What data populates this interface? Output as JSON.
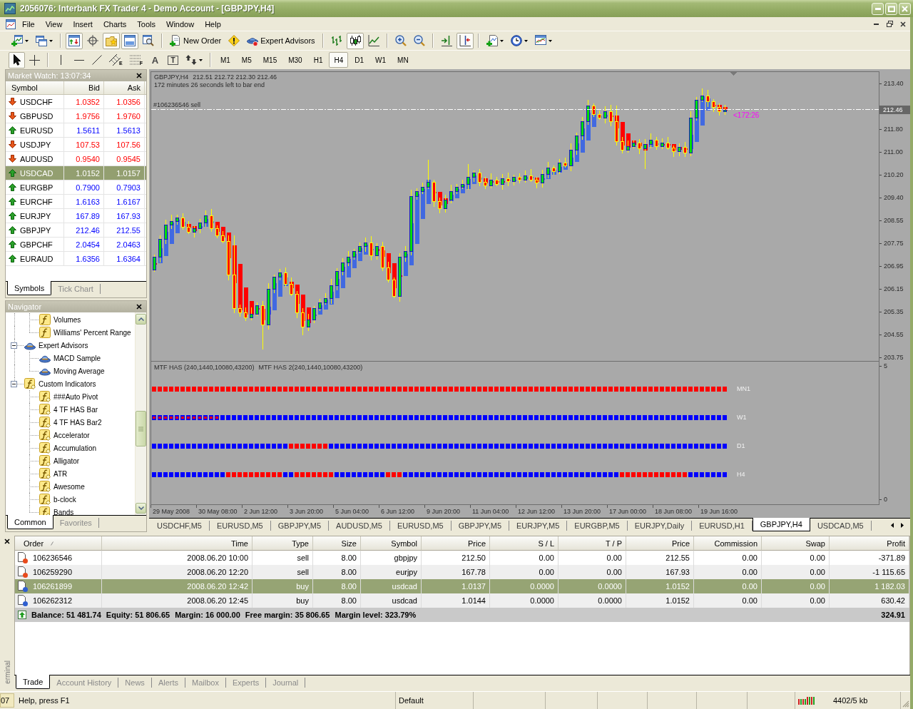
{
  "window": {
    "title": "2056076: Interbank FX Trader 4 - Demo Account - [GBPJPY,H4]"
  },
  "menu": [
    "File",
    "View",
    "Insert",
    "Charts",
    "Tools",
    "Window",
    "Help"
  ],
  "toolbar": [
    [
      {
        "pressed": false
      },
      {
        "pressed": false
      }
    ],
    [
      {
        "pressed": true
      },
      {
        "pressed": false
      },
      {
        "pressed": true
      },
      {
        "pressed": true
      },
      {
        "pressed": false
      }
    ],
    [
      {
        "label": "New Order",
        "pressed": false
      },
      {
        "pressed": false
      },
      {
        "label": "Expert Advisors",
        "pressed": false
      }
    ],
    [
      {
        "pressed": false
      },
      {
        "pressed": true
      },
      {
        "pressed": false
      }
    ],
    [
      {
        "pressed": false
      },
      {
        "pressed": false
      }
    ],
    [
      {
        "pressed": false
      },
      {
        "pressed": true
      }
    ],
    [
      {
        "pressed": false
      },
      {
        "pressed": false
      },
      {
        "pressed": false
      }
    ]
  ],
  "drawing_toolbar": [
    [
      {
        "pressed": true
      },
      {
        "pressed": false
      }
    ],
    [
      {
        "pressed": false
      },
      {
        "pressed": false
      },
      {
        "pressed": false
      },
      {
        "badge": "E",
        "pressed": false
      },
      {
        "badge": "F",
        "pressed": false
      },
      {
        "label": "A",
        "pressed": false
      },
      {
        "label": "T",
        "pressed": false
      },
      {
        "pressed": false
      }
    ]
  ],
  "timeframes": [
    {
      "label": "M1",
      "selected": false
    },
    {
      "label": "M5",
      "selected": false
    },
    {
      "label": "M15",
      "selected": false
    },
    {
      "label": "M30",
      "selected": false
    },
    {
      "label": "H1",
      "selected": false
    },
    {
      "label": "H4",
      "selected": true
    },
    {
      "label": "D1",
      "selected": false
    },
    {
      "label": "W1",
      "selected": false
    },
    {
      "label": "MN",
      "selected": false
    }
  ],
  "market_watch": {
    "title": "Market Watch: 13:07:34",
    "columns": [
      "Symbol",
      "Bid",
      "Ask"
    ],
    "rows": [
      {
        "symbol": "USDCHF",
        "bid": "1.0352",
        "ask": "1.0356",
        "kind": "down",
        "selected": false
      },
      {
        "symbol": "GBPUSD",
        "bid": "1.9756",
        "ask": "1.9760",
        "kind": "down",
        "selected": false
      },
      {
        "symbol": "EURUSD",
        "bid": "1.5611",
        "ask": "1.5613",
        "kind": "up",
        "selected": false
      },
      {
        "symbol": "USDJPY",
        "bid": "107.53",
        "ask": "107.56",
        "kind": "down",
        "selected": false
      },
      {
        "symbol": "AUDUSD",
        "bid": "0.9540",
        "ask": "0.9545",
        "kind": "down",
        "selected": false
      },
      {
        "symbol": "USDCAD",
        "bid": "1.0152",
        "ask": "1.0157",
        "kind": "up",
        "selected": true
      },
      {
        "symbol": "EURGBP",
        "bid": "0.7900",
        "ask": "0.7903",
        "kind": "up",
        "selected": false
      },
      {
        "symbol": "EURCHF",
        "bid": "1.6163",
        "ask": "1.6167",
        "kind": "up",
        "selected": false
      },
      {
        "symbol": "EURJPY",
        "bid": "167.89",
        "ask": "167.93",
        "kind": "up",
        "selected": false
      },
      {
        "symbol": "GBPJPY",
        "bid": "212.46",
        "ask": "212.55",
        "kind": "up",
        "selected": false
      },
      {
        "symbol": "GBPCHF",
        "bid": "2.0454",
        "ask": "2.0463",
        "kind": "up",
        "selected": false
      },
      {
        "symbol": "EURAUD",
        "bid": "1.6356",
        "ask": "1.6364",
        "kind": "up",
        "selected": false
      }
    ],
    "tabs": [
      {
        "label": "Symbols",
        "selected": true
      },
      {
        "label": "Tick Chart",
        "selected": false
      }
    ]
  },
  "navigator": {
    "title": "Navigator",
    "tree": [
      {
        "children": [
          {
            "label": "Volumes",
            "kind": "indicator"
          },
          {
            "label": "Williams' Percent Range",
            "kind": "indicator"
          }
        ]
      },
      {
        "label": "Expert Advisors",
        "kind": "expert",
        "expanded": true,
        "children": [
          {
            "label": "MACD Sample",
            "kind": "expert"
          },
          {
            "label": "Moving Average",
            "kind": "expert"
          }
        ]
      },
      {
        "label": "Custom Indicators",
        "kind": "custom",
        "expanded": true,
        "children": [
          {
            "label": "###Auto Pivot",
            "kind": "custom"
          },
          {
            "label": "4 TF HAS Bar",
            "kind": "custom"
          },
          {
            "label": "4 TF HAS Bar2",
            "kind": "custom"
          },
          {
            "label": "Accelerator",
            "kind": "custom"
          },
          {
            "label": "Accumulation",
            "kind": "custom"
          },
          {
            "label": "Alligator",
            "kind": "custom"
          },
          {
            "label": "ATR",
            "kind": "custom"
          },
          {
            "label": "Awesome",
            "kind": "custom"
          },
          {
            "label": "b-clock",
            "kind": "custom"
          },
          {
            "label": "Bands",
            "kind": "custom"
          }
        ]
      }
    ],
    "tabs": [
      {
        "label": "Common",
        "selected": true
      },
      {
        "label": "Favorites",
        "selected": false
      }
    ]
  },
  "chart": {
    "symbol": "GBPJPY,H4",
    "ohlc": "212.51 212.72 212.30 212.46",
    "timer": "172 minutes 26 seconds left to bar end",
    "order_tag": "#106236546 sell",
    "countdown": "<172:26",
    "current_price": "212.46",
    "price_scale": [
      "213.40",
      "211.80",
      "211.00",
      "210.20",
      "209.40",
      "208.55",
      "207.75",
      "206.95",
      "206.15",
      "205.35",
      "204.55",
      "203.75"
    ],
    "time_scale": [
      "29 May 2008",
      "30 May 08:00",
      "2 Jun 12:00",
      "3 Jun 20:00",
      "5 Jun 04:00",
      "6 Jun 12:00",
      "9 Jun 20:00",
      "11 Jun 04:00",
      "12 Jun 12:00",
      "13 Jun 20:00",
      "17 Jun 00:00",
      "18 Jun 08:00",
      "19 Jun 16:00"
    ],
    "indicator": {
      "titles": [
        "MTF HAS (240,1440,10080,43200)",
        "MTF HAS 2(240,1440,10080,43200)"
      ],
      "rows": [
        "MN1",
        "W1",
        "D1",
        "H4"
      ],
      "scale_max": "5",
      "scale_min": "0"
    }
  },
  "chart_tabs": [
    {
      "label": "USDCHF,M5",
      "selected": false
    },
    {
      "label": "EURUSD,M5",
      "selected": false
    },
    {
      "label": "GBPJPY,M5",
      "selected": false
    },
    {
      "label": "AUDUSD,M5",
      "selected": false
    },
    {
      "label": "EURUSD,M5",
      "selected": false
    },
    {
      "label": "GBPJPY,M5",
      "selected": false
    },
    {
      "label": "EURJPY,M5",
      "selected": false
    },
    {
      "label": "EURGBP,M5",
      "selected": false
    },
    {
      "label": "EURJPY,Daily",
      "selected": false
    },
    {
      "label": "EURUSD,H1",
      "selected": false
    },
    {
      "label": "GBPJPY,H4",
      "selected": true
    },
    {
      "label": "USDCAD,M5",
      "selected": false
    }
  ],
  "terminal": {
    "side_label": "erminal",
    "columns": [
      {
        "label": "Order",
        "sorted": true
      },
      {
        "label": "Time",
        "sorted": false
      },
      {
        "label": "Type",
        "sorted": false
      },
      {
        "label": "Size",
        "sorted": false
      },
      {
        "label": "Symbol",
        "sorted": false
      },
      {
        "label": "Price",
        "sorted": false
      },
      {
        "label": "S / L",
        "sorted": false
      },
      {
        "label": "T / P",
        "sorted": false
      },
      {
        "label": "Price",
        "sorted": false
      },
      {
        "label": "Commission",
        "sorted": false
      },
      {
        "label": "Swap",
        "sorted": false
      },
      {
        "label": "Profit",
        "sorted": false
      }
    ],
    "rows": [
      {
        "color": "#e84a1c",
        "selected": false,
        "cells": [
          "106236546",
          "2008.06.20 10:00",
          "sell",
          "8.00",
          "gbpjpy",
          "212.50",
          "0.00",
          "0.00",
          "212.55",
          "0.00",
          "0.00",
          "-371.89"
        ]
      },
      {
        "color": "#e84a1c",
        "selected": false,
        "cells": [
          "106259290",
          "2008.06.20 12:20",
          "sell",
          "8.00",
          "eurjpy",
          "167.78",
          "0.00",
          "0.00",
          "167.93",
          "0.00",
          "0.00",
          "-1 115.65"
        ]
      },
      {
        "color": "#2f5fd0",
        "selected": true,
        "cells": [
          "106261899",
          "2008.06.20 12:42",
          "buy",
          "8.00",
          "usdcad",
          "1.0137",
          "0.0000",
          "0.0000",
          "1.0152",
          "0.00",
          "0.00",
          "1 182.03"
        ]
      },
      {
        "color": "#2f5fd0",
        "selected": false,
        "cells": [
          "106262312",
          "2008.06.20 12:45",
          "buy",
          "8.00",
          "usdcad",
          "1.0144",
          "0.0000",
          "0.0000",
          "1.0152",
          "0.00",
          "0.00",
          "630.42"
        ]
      }
    ],
    "summary": {
      "items": [
        "Balance: 51 481.74",
        "Equity: 51 806.65",
        "Margin: 16 000.00",
        "Free margin: 35 806.65",
        "Margin level: 323.79%"
      ],
      "profit": "324.91"
    },
    "tabs": [
      {
        "label": "Trade",
        "selected": true
      },
      {
        "label": "Account History",
        "selected": false
      },
      {
        "label": "News",
        "selected": false
      },
      {
        "label": "Alerts",
        "selected": false
      },
      {
        "label": "Mailbox",
        "selected": false
      },
      {
        "label": "Experts",
        "selected": false
      },
      {
        "label": "Journal",
        "selected": false
      }
    ]
  },
  "status_bar": {
    "clock_fragment": "07",
    "help": "Help, press F1",
    "profile": "Default",
    "traffic": "4402/5 kb"
  }
}
